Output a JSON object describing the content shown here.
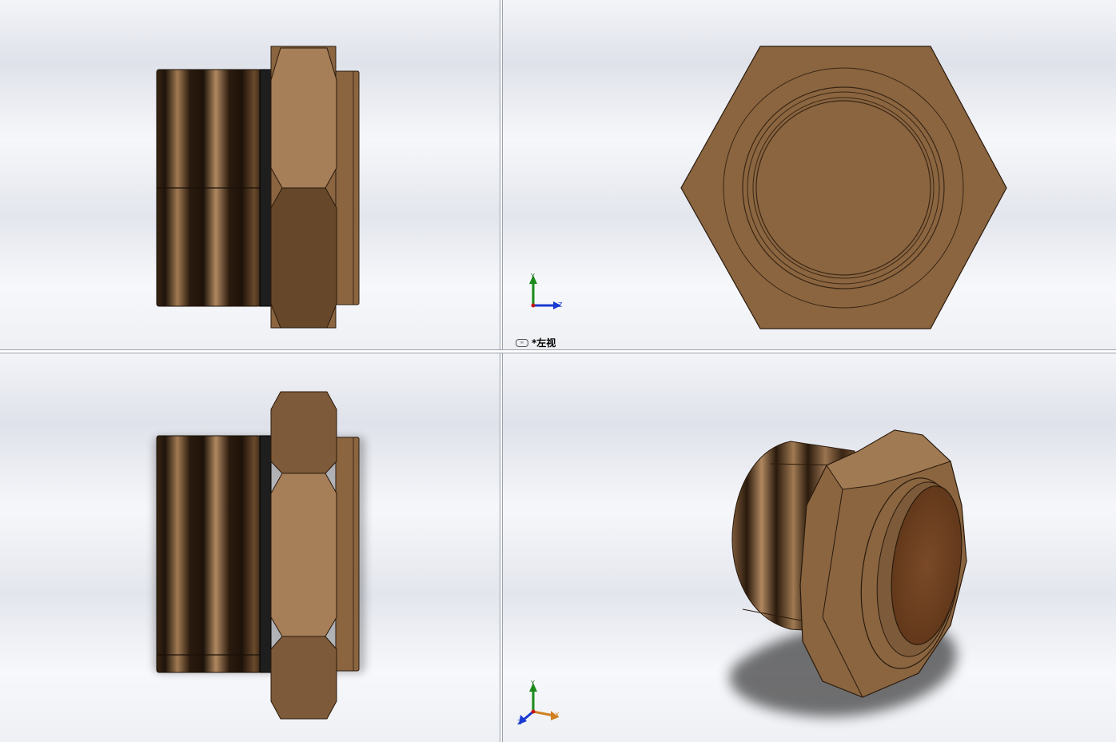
{
  "viewports": {
    "top_right": {
      "view_label": "*左视",
      "triad": {
        "y": "Y",
        "z": "Z",
        "x": "X"
      }
    },
    "bottom_right": {
      "triad": {
        "y": "Y",
        "z": "Z",
        "x": "X"
      }
    }
  },
  "colors": {
    "bronze": "#8a6540",
    "bronze_light": "#a67e58",
    "bronze_dark": "#66472a",
    "thread_dark": "#2e1e10",
    "background": "#eceef3"
  },
  "icons": [
    "view-orientation-icon",
    "coordinate-triad-icon"
  ]
}
